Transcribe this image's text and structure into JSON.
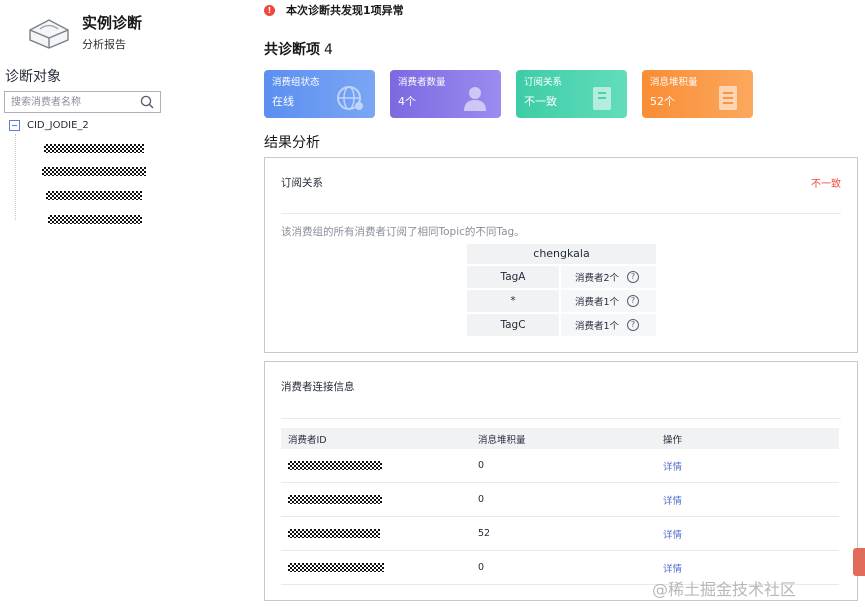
{
  "sidebar": {
    "brand_title": "实例诊断",
    "brand_subtitle": "分析报告",
    "heading": "诊断对象",
    "search_placeholder": "搜索消费者名称",
    "tree_root": "CID_JODIE_2"
  },
  "alert": {
    "text": "本次诊断共发现1项异常",
    "color": "#f0483e"
  },
  "summary": {
    "title": "共诊断项",
    "count": "4",
    "cards": [
      {
        "label": "消费组状态",
        "value": "在线",
        "icon": "globe-icon",
        "color": "#5b8ff0"
      },
      {
        "label": "消费者数量",
        "value": "4个",
        "icon": "user-icon",
        "color": "#7b6ae0"
      },
      {
        "label": "订阅关系",
        "value": "不一致",
        "icon": "book-icon",
        "color": "#3dcca6"
      },
      {
        "label": "消息堆积量",
        "value": "52个",
        "icon": "document-icon",
        "color": "#f98d34"
      }
    ]
  },
  "analysis": {
    "title": "结果分析",
    "subscription": {
      "title": "订阅关系",
      "status": "不一致",
      "description": "该消费组的所有消费者订阅了相同Topic的不同Tag。",
      "topic": "chengkala",
      "rows": [
        {
          "tag": "TagA",
          "consumers": "消费者2个"
        },
        {
          "tag": "*",
          "consumers": "消费者1个"
        },
        {
          "tag": "TagC",
          "consumers": "消费者1个"
        }
      ]
    },
    "connections": {
      "title": "消费者连接信息",
      "headers": [
        "消费者ID",
        "消息堆积量",
        "操作"
      ],
      "rows": [
        {
          "backlog": "0",
          "action": "详情"
        },
        {
          "backlog": "0",
          "action": "详情"
        },
        {
          "backlog": "52",
          "action": "详情"
        },
        {
          "backlog": "0",
          "action": "详情"
        }
      ]
    }
  },
  "watermark": "@稀土掘金技术社区"
}
